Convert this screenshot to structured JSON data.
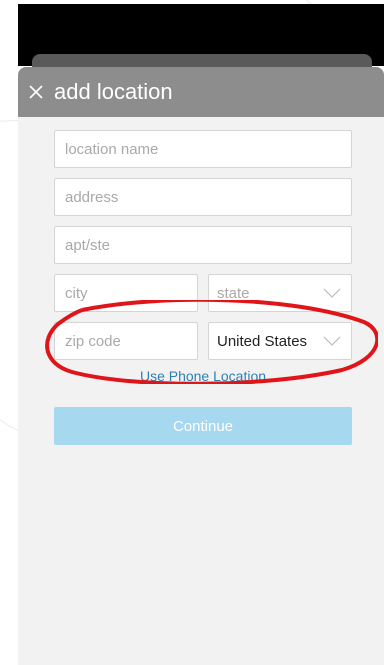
{
  "header": {
    "title": "add location",
    "close_icon": "close-icon"
  },
  "form": {
    "location_name": {
      "placeholder": "location name",
      "value": ""
    },
    "address": {
      "placeholder": "address",
      "value": ""
    },
    "apt": {
      "placeholder": "apt/ste",
      "value": ""
    },
    "city": {
      "placeholder": "city",
      "value": ""
    },
    "state": {
      "placeholder": "state",
      "value": ""
    },
    "zip": {
      "placeholder": "zip code",
      "value": ""
    },
    "country": {
      "value": "United States"
    }
  },
  "actions": {
    "phone_location_label": "Use Phone Location",
    "continue_label": "Continue"
  },
  "colors": {
    "header_bg": "#8d8d8d",
    "link": "#2f7fb0",
    "continue_bg": "#a6d8ef",
    "annotation": "#e0151a"
  }
}
